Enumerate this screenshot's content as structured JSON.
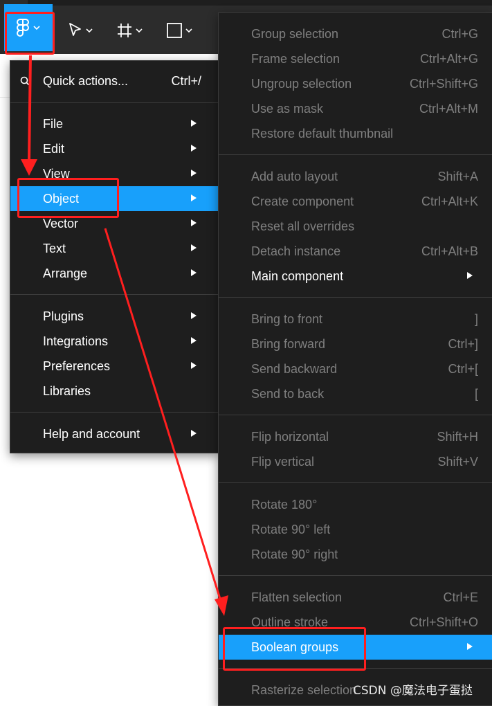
{
  "toolbar": {
    "tools": [
      {
        "name": "figma-menu",
        "icon": "figma-logo-icon"
      },
      {
        "name": "move-tool",
        "icon": "cursor-icon"
      },
      {
        "name": "frame-tool",
        "icon": "frame-icon"
      },
      {
        "name": "shape-tool",
        "icon": "rectangle-icon"
      }
    ],
    "accent": "#18a0fb"
  },
  "main_menu": {
    "quick_actions": {
      "label": "Quick actions...",
      "shortcut": "Ctrl+/"
    },
    "groups": [
      [
        {
          "label": "File",
          "submenu": true
        },
        {
          "label": "Edit",
          "submenu": true
        },
        {
          "label": "View",
          "submenu": true
        },
        {
          "label": "Object",
          "submenu": true,
          "active": true
        },
        {
          "label": "Vector",
          "submenu": true
        },
        {
          "label": "Text",
          "submenu": true
        },
        {
          "label": "Arrange",
          "submenu": true
        }
      ],
      [
        {
          "label": "Plugins",
          "submenu": true
        },
        {
          "label": "Integrations",
          "submenu": true
        },
        {
          "label": "Preferences",
          "submenu": true
        },
        {
          "label": "Libraries",
          "submenu": false
        }
      ],
      [
        {
          "label": "Help and account",
          "submenu": true
        }
      ]
    ]
  },
  "object_menu": {
    "groups": [
      [
        {
          "label": "Group selection",
          "shortcut": "Ctrl+G",
          "disabled": true
        },
        {
          "label": "Frame selection",
          "shortcut": "Ctrl+Alt+G",
          "disabled": true
        },
        {
          "label": "Ungroup selection",
          "shortcut": "Ctrl+Shift+G",
          "disabled": true
        },
        {
          "label": "Use as mask",
          "shortcut": "Ctrl+Alt+M",
          "disabled": true
        },
        {
          "label": "Restore default thumbnail",
          "shortcut": "",
          "disabled": true
        }
      ],
      [
        {
          "label": "Add auto layout",
          "shortcut": "Shift+A",
          "disabled": true
        },
        {
          "label": "Create component",
          "shortcut": "Ctrl+Alt+K",
          "disabled": true
        },
        {
          "label": "Reset all overrides",
          "shortcut": "",
          "disabled": true
        },
        {
          "label": "Detach instance",
          "shortcut": "Ctrl+Alt+B",
          "disabled": true
        },
        {
          "label": "Main component",
          "shortcut": "",
          "disabled": false,
          "submenu": true
        }
      ],
      [
        {
          "label": "Bring to front",
          "shortcut": "]",
          "disabled": true
        },
        {
          "label": "Bring forward",
          "shortcut": "Ctrl+]",
          "disabled": true
        },
        {
          "label": "Send backward",
          "shortcut": "Ctrl+[",
          "disabled": true
        },
        {
          "label": "Send to back",
          "shortcut": "[",
          "disabled": true
        }
      ],
      [
        {
          "label": "Flip horizontal",
          "shortcut": "Shift+H",
          "disabled": true
        },
        {
          "label": "Flip vertical",
          "shortcut": "Shift+V",
          "disabled": true
        }
      ],
      [
        {
          "label": "Rotate 180°",
          "shortcut": "",
          "disabled": true
        },
        {
          "label": "Rotate 90° left",
          "shortcut": "",
          "disabled": true
        },
        {
          "label": "Rotate 90° right",
          "shortcut": "",
          "disabled": true
        }
      ],
      [
        {
          "label": "Flatten selection",
          "shortcut": "Ctrl+E",
          "disabled": true
        },
        {
          "label": "Outline stroke",
          "shortcut": "Ctrl+Shift+O",
          "disabled": true
        },
        {
          "label": "Boolean groups",
          "shortcut": "",
          "disabled": false,
          "submenu": true,
          "active": true
        }
      ],
      [
        {
          "label": "Rasterize selection",
          "shortcut": "",
          "disabled": true
        }
      ]
    ]
  },
  "annotation_color": "#ff1f1f",
  "watermark": "CSDN @魔法电子蛋挞"
}
